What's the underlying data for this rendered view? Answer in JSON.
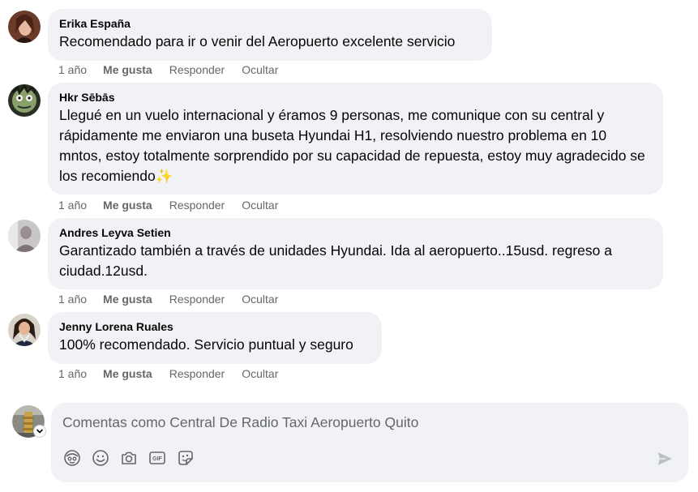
{
  "comments": [
    {
      "author": "Erika España",
      "text": "Recomendado para ir o venir del Aeropuerto excelente servicio",
      "age": "1 año",
      "like": "Me gusta",
      "reply": "Responder",
      "hide": "Ocultar"
    },
    {
      "author": "Hkr Sēbās",
      "text": "Llegué en un vuelo internacional y éramos 9 personas, me comunique con su central y rápidamente me enviaron una buseta Hyundai H1, resolviendo nuestro problema en 10 mntos, estoy totalmente sorprendido por su capacidad de repuesta, estoy muy agradecido se los recomiendo✨",
      "age": "1 año",
      "like": "Me gusta",
      "reply": "Responder",
      "hide": "Ocultar"
    },
    {
      "author": "Andres Leyva Setien",
      "text": "Garantizado también a través de unidades Hyundai. Ida al aeropuerto..15usd. regreso a ciudad.12usd.",
      "age": "1 año",
      "like": "Me gusta",
      "reply": "Responder",
      "hide": "Ocultar"
    },
    {
      "author": "Jenny Lorena Ruales",
      "text": "100% recomendado. Servicio puntual y seguro",
      "age": "1 año",
      "like": "Me gusta",
      "reply": "Responder",
      "hide": "Ocultar"
    }
  ],
  "composer": {
    "placeholder": "Comentas como Central De Radio Taxi Aeropuerto Quito",
    "icons": [
      "avatar-sticker-icon",
      "emoji-icon",
      "camera-icon",
      "gif-icon",
      "sticker-icon",
      "send-icon"
    ]
  },
  "colors": {
    "bubble": "#f0f2f5",
    "meta": "#65676b",
    "text": "#050505"
  }
}
